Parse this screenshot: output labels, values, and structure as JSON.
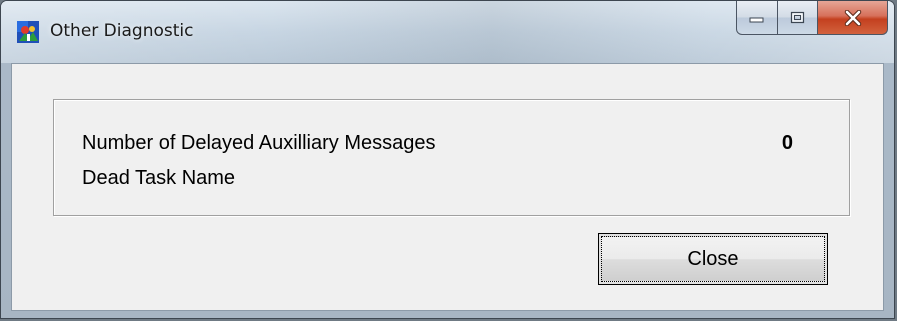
{
  "window": {
    "title": "Other Diagnostic",
    "app_icon": "app-icon",
    "caption_buttons": {
      "minimize_icon": "minimize-icon",
      "maximize_icon": "maximize-icon",
      "close_icon": "close-x-icon",
      "close_color": "#c4401f"
    }
  },
  "diagnostics": {
    "rows": [
      {
        "label": "Number of Delayed Auxilliary Messages",
        "value": "0"
      },
      {
        "label": "Dead Task Name",
        "value": ""
      }
    ]
  },
  "footer": {
    "close_label": "Close"
  }
}
